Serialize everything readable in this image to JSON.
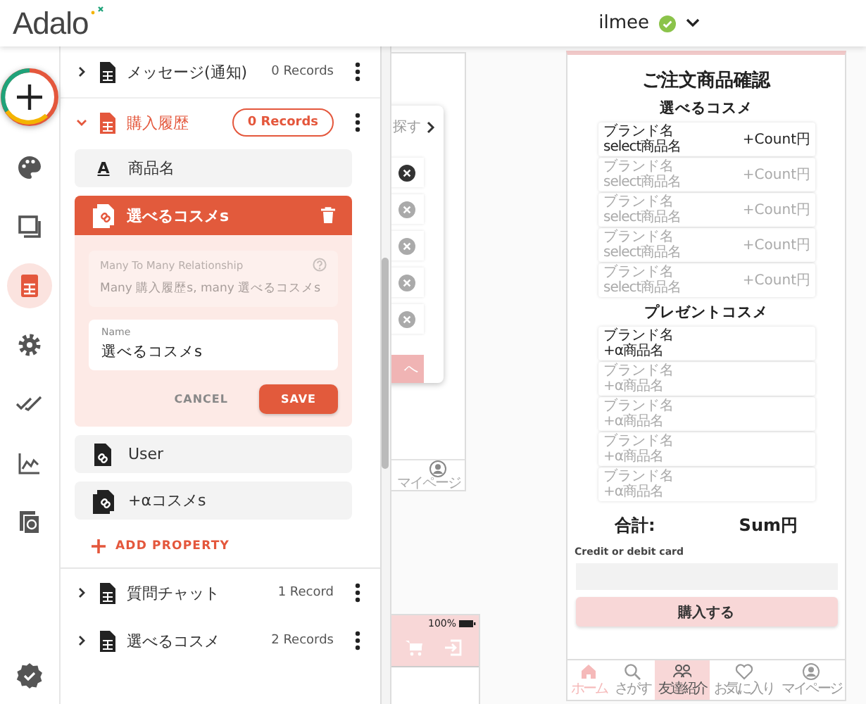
{
  "header": {
    "logo": "Adalo",
    "user": "ilmee",
    "verified": true
  },
  "rail": [
    {
      "kind": "add",
      "selected": false
    },
    {
      "kind": "palette",
      "selected": false
    },
    {
      "kind": "screens",
      "selected": false
    },
    {
      "kind": "database",
      "selected": true
    },
    {
      "kind": "settings",
      "selected": false
    },
    {
      "kind": "checks",
      "selected": false
    },
    {
      "kind": "analytics",
      "selected": false
    },
    {
      "kind": "document",
      "selected": false
    },
    {
      "kind": "publish",
      "selected": false
    }
  ],
  "collections": [
    {
      "name": "メッセージ(通知)",
      "records": "0 Records",
      "expanded": false
    },
    {
      "name": "購入履歴",
      "records": "0 Records",
      "expanded": true,
      "properties": [
        {
          "kind": "text",
          "icon": "A",
          "name": "商品名",
          "editing": false
        },
        {
          "kind": "many",
          "name": "選べるコスメs",
          "editing": true,
          "relation_label": "Many To Many Relationship",
          "relation": "Many 購入履歴s, many 選べるコスメs",
          "field_label": "Name",
          "value": "選べるコスメs",
          "cancel": "CANCEL",
          "save": "SAVE"
        },
        {
          "kind": "one",
          "name": "User",
          "editing": false
        },
        {
          "kind": "many",
          "name": "+αコスメs",
          "editing": false
        }
      ],
      "add_property": "ADD PROPERTY"
    },
    {
      "name": "質問チャット",
      "records": "1 Record",
      "expanded": false
    },
    {
      "name": "選べるコスメ",
      "records": "2 Records",
      "expanded": false
    }
  ],
  "preview_left": {
    "popover_title": "探す",
    "rows": [
      {
        "dimmed": false
      },
      {
        "dimmed": true
      },
      {
        "dimmed": true
      },
      {
        "dimmed": true
      },
      {
        "dimmed": true
      }
    ],
    "button": "へ",
    "nav_label": "マイページ"
  },
  "preview_bottom": {
    "battery": "100%"
  },
  "phone": {
    "title": "ご注文商品確認",
    "sections": [
      {
        "title": "選べるコスメ",
        "items": [
          {
            "brand": "ブランド名",
            "product": "select商品名",
            "price": "+Count円",
            "dimmed": false
          },
          {
            "brand": "ブランド名",
            "product": "select商品名",
            "price": "+Count円",
            "dimmed": true
          },
          {
            "brand": "ブランド名",
            "product": "select商品名",
            "price": "+Count円",
            "dimmed": true
          },
          {
            "brand": "ブランド名",
            "product": "select商品名",
            "price": "+Count円",
            "dimmed": true
          },
          {
            "brand": "ブランド名",
            "product": "select商品名",
            "price": "+Count円",
            "dimmed": true
          }
        ]
      },
      {
        "title": "プレゼントコスメ",
        "items": [
          {
            "brand": "ブランド名",
            "product": "+α商品名",
            "dimmed": false
          },
          {
            "brand": "ブランド名",
            "product": "+α商品名",
            "dimmed": true
          },
          {
            "brand": "ブランド名",
            "product": "+α商品名",
            "dimmed": true
          },
          {
            "brand": "ブランド名",
            "product": "+α商品名",
            "dimmed": true
          },
          {
            "brand": "ブランド名",
            "product": "+α商品名",
            "dimmed": true
          }
        ]
      }
    ],
    "total_label": "合計:",
    "total": "Sum円",
    "card_label": "Credit or debit card",
    "buy": "購入する",
    "tabs": [
      {
        "kind": "home",
        "label": "ホーム",
        "selected": false,
        "faded": true
      },
      {
        "kind": "search",
        "label": "さがす",
        "selected": false,
        "faded": false
      },
      {
        "kind": "friends",
        "label": "友達紹介",
        "selected": true,
        "faded": false
      },
      {
        "kind": "favorite",
        "label": "お気に入り",
        "selected": false,
        "faded": false
      },
      {
        "kind": "account",
        "label": "マイページ",
        "selected": false,
        "faded": false
      }
    ]
  }
}
